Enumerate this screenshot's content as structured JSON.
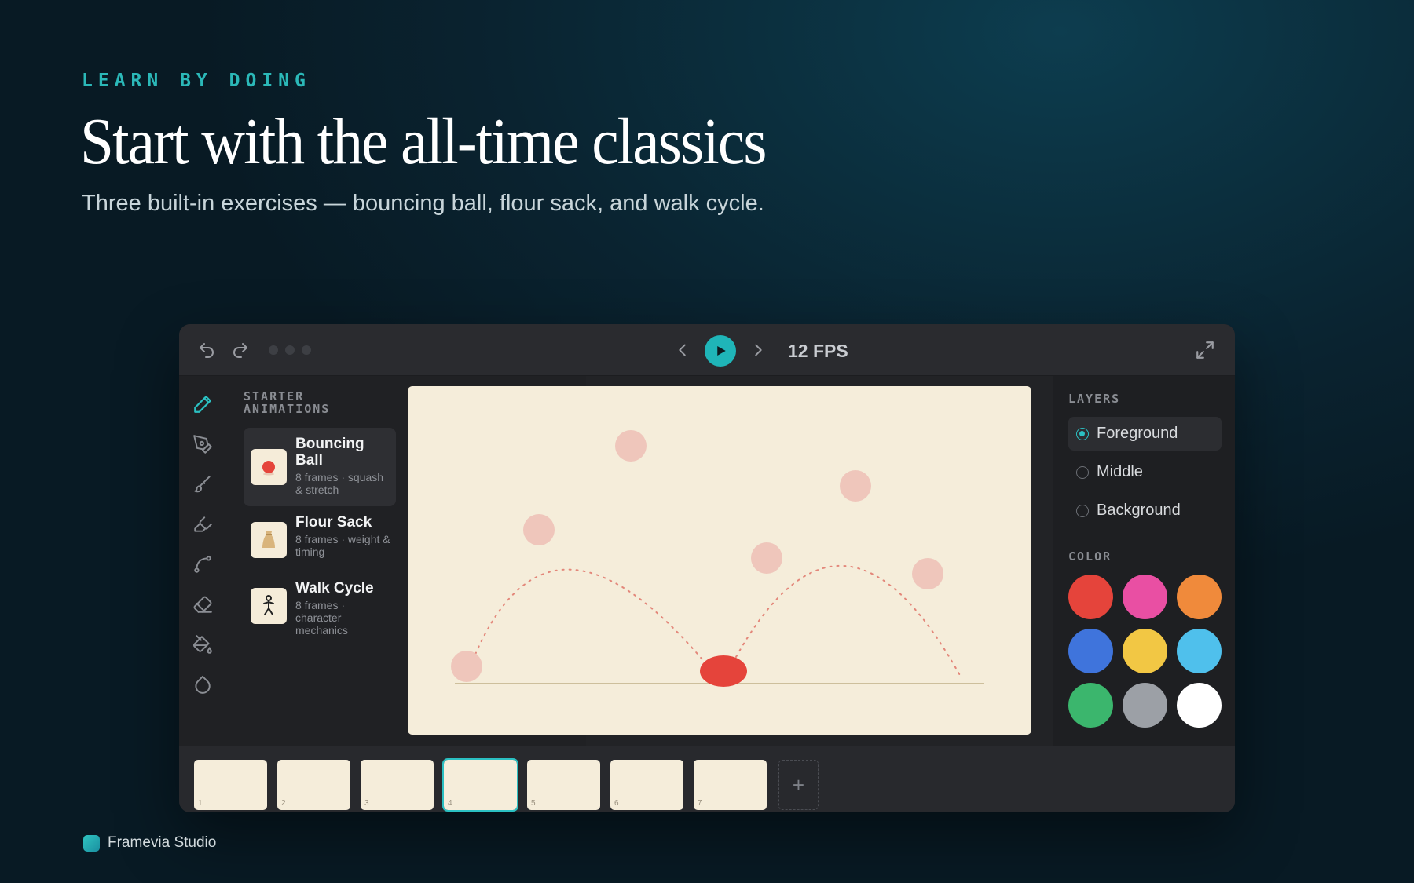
{
  "hero": {
    "eyebrow": "LEARN BY DOING",
    "title": "Start with the all-time classics",
    "subtitle": "Three built-in exercises — bouncing ball, flour sack, and walk cycle."
  },
  "toolbar": {
    "fps_label": "12 FPS",
    "icons": [
      "undo-icon",
      "redo-icon",
      "prev-frame-icon",
      "play-icon",
      "next-frame-icon",
      "fullscreen-icon"
    ]
  },
  "tools": [
    "pencil-icon",
    "pen-icon",
    "brush-icon",
    "highlighter-icon",
    "curve-icon",
    "eraser-icon",
    "fill-icon",
    "dropper-icon"
  ],
  "library": {
    "title": "STARTER ANIMATIONS",
    "items": [
      {
        "name": "Bouncing Ball",
        "meta": "8 frames · squash & stretch",
        "icon": "ball-icon"
      },
      {
        "name": "Flour Sack",
        "meta": "8 frames · weight & timing",
        "icon": "sack-icon"
      },
      {
        "name": "Walk Cycle",
        "meta": "8 frames · character mechanics",
        "icon": "stick-figure-icon"
      }
    ]
  },
  "layers": {
    "title": "LAYERS",
    "items": [
      "Foreground",
      "Middle",
      "Background"
    ],
    "selected": "Foreground"
  },
  "color": {
    "title": "COLOR",
    "swatches": [
      "#e5443b",
      "#e94fa3",
      "#f08a3b",
      "#3f74dc",
      "#f2c744",
      "#4fc0ec",
      "#3bb66d",
      "#9ca0a6",
      "#ffffff"
    ]
  },
  "timeline": {
    "frames": [
      "1",
      "2",
      "3",
      "4",
      "5",
      "6",
      "7"
    ],
    "current_frame": "4",
    "add_label": "+"
  },
  "brand": {
    "name": "Framevia Studio"
  },
  "colors": {
    "accent": "#2bc0c2",
    "ball": "#e5443b",
    "ghost": "#efc6bb",
    "canvas": "#f5edda"
  }
}
